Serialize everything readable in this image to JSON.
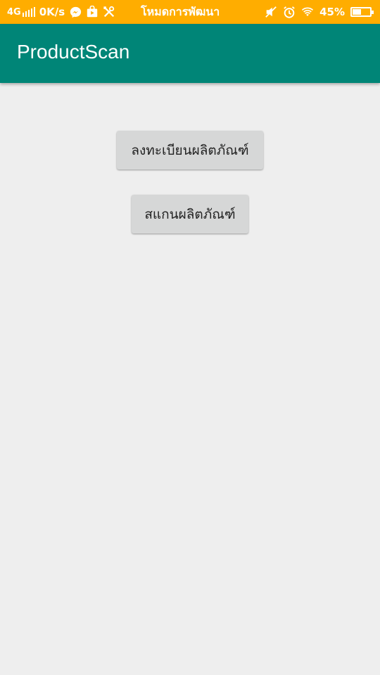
{
  "status_bar": {
    "network": "4G",
    "speed": "0K/s",
    "mode_text": "โหมดการพัฒนา",
    "battery": "45%",
    "battery_level": 0.45,
    "icons": [
      "messenger-icon",
      "play-store-icon",
      "tools-icon",
      "mute-icon",
      "alarm-icon",
      "wifi-icon",
      "battery-icon"
    ]
  },
  "app_bar": {
    "title": "ProductScan",
    "color": "#008577"
  },
  "main": {
    "register_button": "ลงทะเบียนผลิตภัณฑ์",
    "scan_button": "สแกนผลิตภัณฑ์"
  },
  "colors": {
    "status_bar": "#ffad00",
    "background": "#eeeeee",
    "button": "#d6d7d7"
  }
}
